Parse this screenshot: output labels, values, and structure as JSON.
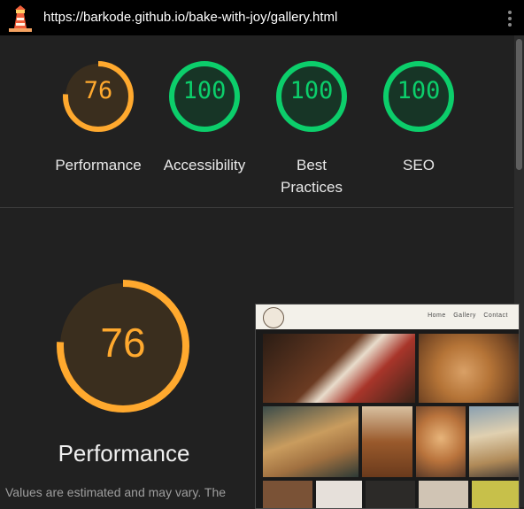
{
  "topbar": {
    "url": "https://barkode.github.io/bake-with-joy/gallery.html",
    "logo_icon": "lighthouse-icon",
    "menu_icon": "kebab-menu-icon"
  },
  "gauges": [
    {
      "score": "76",
      "label": "Performance",
      "value": 76,
      "color": "#ffa92e"
    },
    {
      "score": "100",
      "label": "Accessibility",
      "value": 100,
      "color": "#0cce6b"
    },
    {
      "score": "100",
      "label": "Best Practices",
      "value": 100,
      "color": "#0cce6b"
    },
    {
      "score": "100",
      "label": "SEO",
      "value": 100,
      "color": "#0cce6b"
    }
  ],
  "performance": {
    "score": "76",
    "value": 76,
    "title": "Performance",
    "note": "Values are estimated and may vary. The"
  },
  "thumbnail": {
    "nav_links": [
      "Home",
      "Gallery",
      "Contact"
    ]
  },
  "colors": {
    "average": "#ffa92e",
    "pass": "#0cce6b",
    "background": "#212121"
  }
}
